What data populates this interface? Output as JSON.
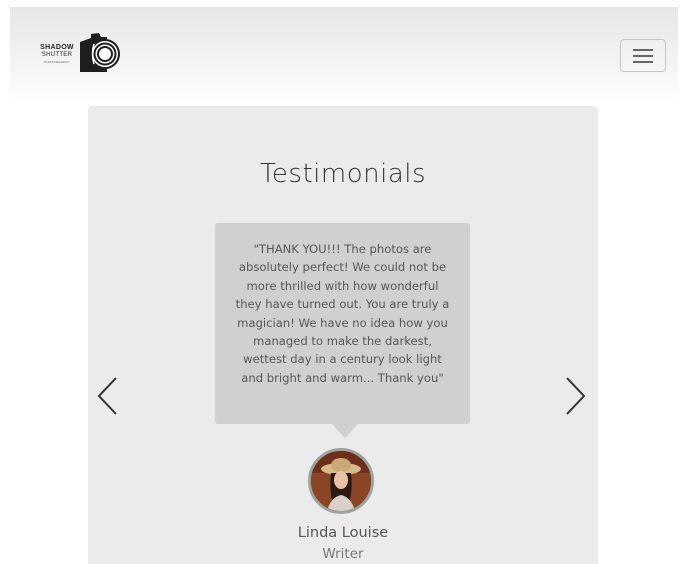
{
  "header": {
    "logo": {
      "line1": "SHADOW",
      "line2": "SHUTTER",
      "line3": "PHOTOGRAPHY",
      "icon": "camera-icon"
    },
    "menu_icon": "hamburger-menu-icon"
  },
  "testimonials": {
    "title": "Testimonials",
    "quote": "\"THANK YOU!!! The photos are absolutely perfect! We could not be more thrilled with how wonderful they have turned out. You are truly a magician! We have no idea how you managed to make the darkest, wettest day in a century look light and bright and warm... Thank you\"",
    "person_name": "Linda Louise",
    "person_role": "Writer",
    "prev_icon": "chevron-left-icon",
    "next_icon": "chevron-right-icon"
  },
  "colors": {
    "section_bg": "#ebebeb",
    "quote_bg": "#d0d0d0",
    "text_dark": "#333333",
    "avatar_ring": "#9aa5a0"
  }
}
